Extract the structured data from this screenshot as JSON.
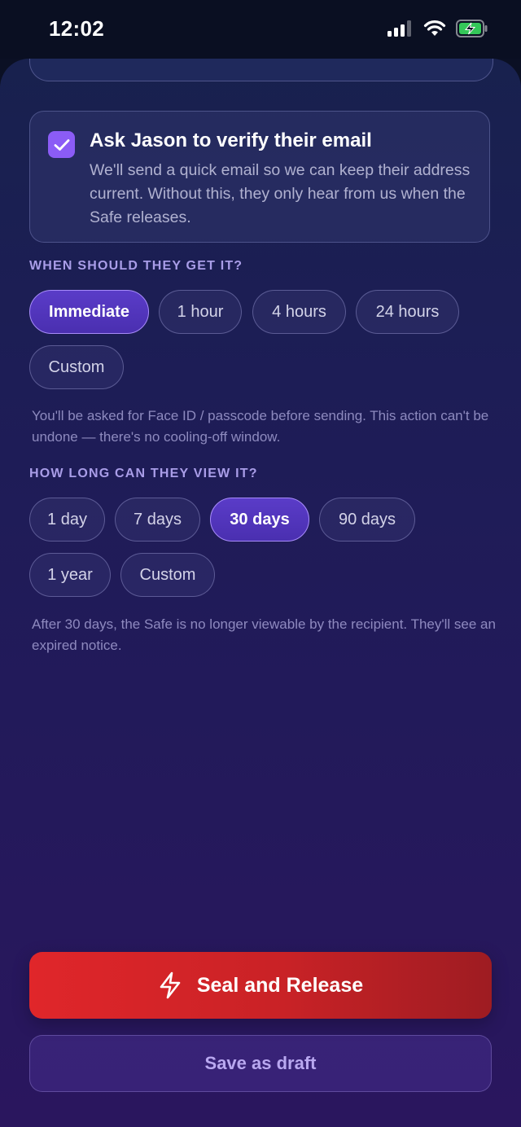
{
  "status_bar": {
    "time": "12:02",
    "icons": [
      "signal-icon",
      "wifi-icon",
      "battery-charging-icon"
    ]
  },
  "verify": {
    "checked": true,
    "title": "Ask Jason to verify their email",
    "description": "We'll send a quick email so we can keep their address current. Without this, they only hear from us when the Safe releases."
  },
  "delivery": {
    "label": "WHEN SHOULD THEY GET IT?",
    "options": [
      "Immediate",
      "1 hour",
      "4 hours",
      "24 hours",
      "Custom"
    ],
    "selected": "Immediate",
    "note": "You'll be asked for Face ID / passcode before sending. This action can't be undone — there's no cooling-off window."
  },
  "viewing": {
    "label": "HOW LONG CAN THEY VIEW IT?",
    "options": [
      "1 day",
      "7 days",
      "30 days",
      "90 days",
      "1 year",
      "Custom"
    ],
    "selected": "30 days",
    "note": "After 30 days, the Safe is no longer viewable by the recipient. They'll see an expired notice."
  },
  "actions": {
    "primary_label": "Seal and Release",
    "primary_icon": "lightning-icon",
    "secondary_label": "Save as draft"
  },
  "colors": {
    "accent": "#8b5cf6",
    "primary_button": "#d62328",
    "background": "#1d1d56"
  }
}
